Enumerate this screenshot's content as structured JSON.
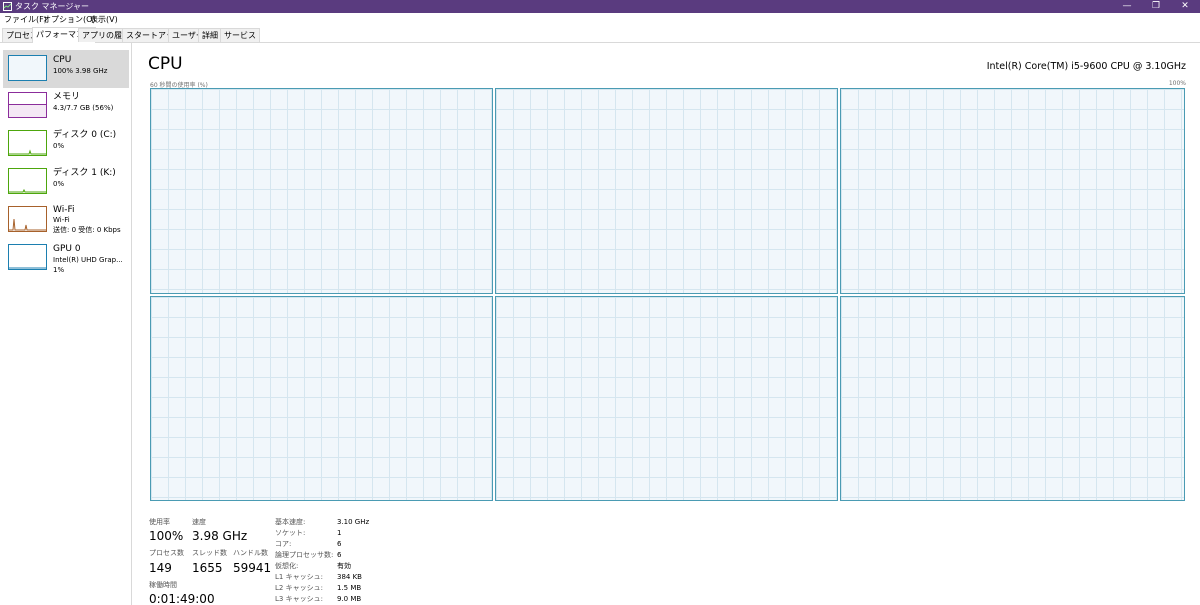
{
  "window": {
    "title": "タスク マネージャー",
    "minimize_glyph": "—",
    "restore_glyph": "❐",
    "close_glyph": "✕"
  },
  "menu": {
    "items": [
      "ファイル(F)",
      "オプション(O)",
      "表示(V)"
    ]
  },
  "tabs": [
    "プロセス",
    "パフォーマンス",
    "アプリの履歴",
    "スタートアップ",
    "ユーザー",
    "詳細",
    "サービス"
  ],
  "active_tab": "パフォーマンス",
  "sidebar": {
    "items": [
      {
        "title": "CPU",
        "sub1": "100%  3.98 GHz",
        "sub2": "",
        "color": "#1c7fb0"
      },
      {
        "title": "メモリ",
        "sub1": "4.3/7.7 GB (56%)",
        "sub2": "",
        "color": "#8b2d9b"
      },
      {
        "title": "ディスク 0 (C:)",
        "sub1": "0%",
        "sub2": "",
        "color": "#4da60c"
      },
      {
        "title": "ディスク 1 (K:)",
        "sub1": "0%",
        "sub2": "",
        "color": "#4da60c"
      },
      {
        "title": "Wi-Fi",
        "sub1": "Wi-Fi",
        "sub2": "送信: 0  受信: 0 Kbps",
        "color": "#a7612b"
      },
      {
        "title": "GPU 0",
        "sub1": "Intel(R) UHD Grap...",
        "sub2": "1%",
        "color": "#1c7fb0"
      }
    ]
  },
  "main": {
    "title": "CPU",
    "model": "Intel(R) Core(TM) i5-9600 CPU @ 3.10GHz",
    "axis_left": "60 秒間の使用率 (%)",
    "axis_right": "100%",
    "graph_border": "#4a9bb3",
    "graph_bg": "#f1f7fb"
  },
  "stats": {
    "usage_label": "使用率",
    "usage_value": "100%",
    "speed_label": "速度",
    "speed_value": "3.98 GHz",
    "processes_label": "プロセス数",
    "processes_value": "149",
    "threads_label": "スレッド数",
    "threads_value": "1655",
    "handles_label": "ハンドル数",
    "handles_value": "59941",
    "uptime_label": "稼働時間",
    "uptime_value": "0:01:49:00"
  },
  "details": [
    {
      "key": "基本速度:",
      "value": "3.10 GHz"
    },
    {
      "key": "ソケット:",
      "value": "1"
    },
    {
      "key": "コア:",
      "value": "6"
    },
    {
      "key": "論理プロセッサ数:",
      "value": "6"
    },
    {
      "key": "仮想化:",
      "value": "有効"
    },
    {
      "key": "L1 キャッシュ:",
      "value": "384 KB"
    },
    {
      "key": "L2 キャッシュ:",
      "value": "1.5 MB"
    },
    {
      "key": "L3 キャッシュ:",
      "value": "9.0 MB"
    }
  ]
}
